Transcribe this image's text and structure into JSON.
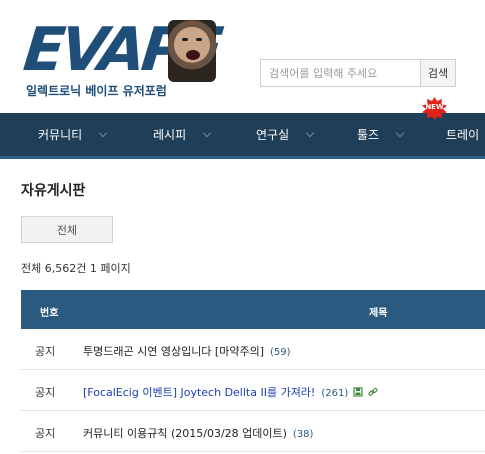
{
  "brand": {
    "logo_text": "EVAPE",
    "tagline": "일렉트로닉 베이프 유저포럼"
  },
  "search": {
    "placeholder": "검색어를 입력해 주세요",
    "button_label": "검색"
  },
  "nav": {
    "items": [
      {
        "label": "커뮤니티"
      },
      {
        "label": "레시피"
      },
      {
        "label": "연구실"
      },
      {
        "label": "툴즈"
      },
      {
        "label": "트레이"
      }
    ],
    "new_badge": "NEW"
  },
  "board": {
    "title": "자유게시판",
    "filter_label": "전체",
    "summary": "전체 6,562건 1 페이지",
    "columns": {
      "number": "번호",
      "title": "제목"
    },
    "rows": [
      {
        "number": "공지",
        "title": "투명드래곤 시연 영상입니다 [마약주의]",
        "count": "(59)"
      },
      {
        "number": "공지",
        "title": "[FocalEcig 이벤트] Joytech Dellta II를 가져라!",
        "count": "(261)",
        "icons": [
          "file-icon",
          "link-icon"
        ]
      },
      {
        "number": "공지",
        "title": "커뮤니티 이용규칙 (2015/03/28 업데이트)",
        "count": "(38)"
      }
    ]
  },
  "colors": {
    "brand": "#1f4f78",
    "nav_bg": "#1f3e57",
    "table_header": "#2a5a80",
    "link_blue": "#1b3fb0",
    "badge_red": "#e2231a"
  }
}
